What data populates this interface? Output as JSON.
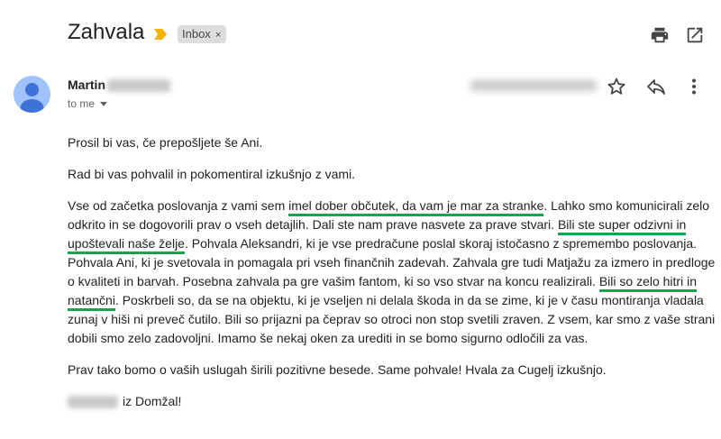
{
  "subject": "Zahvala",
  "label": "Inbox",
  "label_close": "×",
  "sender": {
    "first_name": "Martin",
    "to_label": "to me"
  },
  "icons": [
    "print-icon",
    "open-in-new-window-icon",
    "star-icon",
    "reply-icon",
    "more-vert-icon",
    "important-marker-icon",
    "avatar-person-icon"
  ],
  "colors": {
    "highlight": "#1aa34a",
    "important": "#f4b400",
    "avatar_bg": "#a0c3ff"
  },
  "body": {
    "p1": "Prosil bi vas, če prepošljete še Ani.",
    "p2": "Rad bi vas pohvalil in pokomentiral izkušnjo z vami.",
    "p3_a": "Vse od začetka poslovanja z vami sem ",
    "p3_hl1": "imel dober občutek, da vam je mar za stranke",
    "p3_b": ". Lahko smo komunicirali zelo odkrito in se dogovorili prav o vseh detajlih. Dali ste nam prave nasvete za prave stvari. ",
    "p3_hl2": "Bili ste super odzivni in upoštevali naše želje",
    "p3_c": ". Pohvala Aleksandri, ki je vse predračune poslal skoraj istočasno z spremembo poslovanja. Pohvala Ani, ki je svetovala in pomagala pri vseh finančnih zadevah. Zahvala gre tudi Matjažu za izmero in predloge o kvaliteti in barvah. Posebna zahvala pa gre vašim fantom, ki so vso stvar na koncu realizirali. ",
    "p3_hl3": "Bili so zelo hitri in natančni",
    "p3_d": ". Poskrbeli so, da se na objektu, ki je vseljen ni delala škoda in da se zime, ki je v času montiranja vladala zunaj v hiši ni preveč čutilo. Bili so prijazni pa čeprav so otroci non stop svetili zraven. Z vsem, kar smo z vaše strani dobili smo zelo zadovoljni. Imamo še nekaj oken za urediti in se bomo sigurno odločili za vas.",
    "p4": "Prav tako bomo o vaših uslugah širili pozitivne besede. Same pohvale! Hvala za Cugelj izkušnjo.",
    "p5_suffix": "iz Domžal!"
  }
}
